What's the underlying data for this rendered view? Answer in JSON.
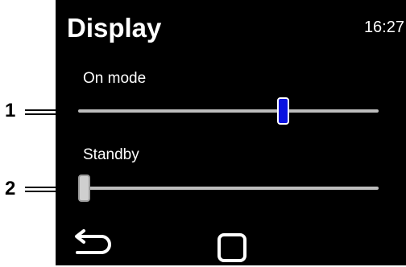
{
  "header": {
    "title": "Display",
    "time": "16:27"
  },
  "sliders": [
    {
      "label": "On mode",
      "value": 0.69,
      "accent": "#0a12e0"
    },
    {
      "label": "Standby",
      "value": 0.0,
      "accent": "#cfcfcf"
    }
  ],
  "callouts": [
    "1",
    "2"
  ],
  "nav": {
    "back_icon": "back-arrow-icon",
    "home_icon": "home-square-icon"
  }
}
